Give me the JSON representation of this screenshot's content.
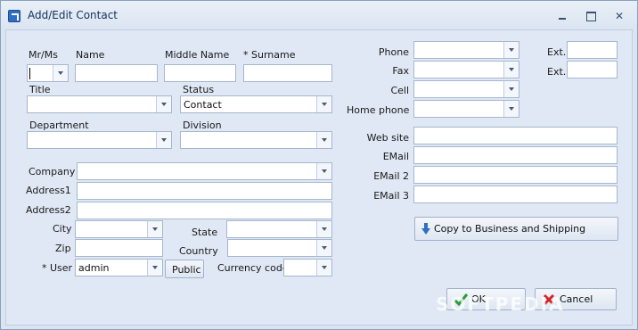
{
  "window": {
    "title": "Add/Edit Contact"
  },
  "labels": {
    "mr_ms": "Mr/Ms",
    "name": "Name",
    "middle_name": "Middle Name",
    "surname": "* Surname",
    "title": "Title",
    "status": "Status",
    "department": "Department",
    "division": "Division",
    "company": "Company",
    "address1": "Address1",
    "address2": "Address2",
    "city": "City",
    "state": "State",
    "zip": "Zip",
    "country": "Country",
    "user": "* User",
    "currency_code": "Currency code",
    "phone": "Phone",
    "fax": "Fax",
    "cell": "Cell",
    "home_phone": "Home phone",
    "ext1": "Ext.",
    "ext2": "Ext.",
    "web_site": "Web site",
    "email": "EMail",
    "email2": "EMail 2",
    "email3": "EMail 3"
  },
  "values": {
    "mr_ms": "",
    "name": "",
    "middle_name": "",
    "surname": "",
    "title": "",
    "status": "Contact",
    "department": "",
    "division": "",
    "company": "",
    "address1": "",
    "address2": "",
    "city": "",
    "state": "",
    "zip": "",
    "country": "",
    "user": "admin",
    "currency_code": "",
    "phone": "",
    "fax": "",
    "cell": "",
    "home_phone": "",
    "ext1": "",
    "ext2": "",
    "web_site": "",
    "email": "",
    "email2": "",
    "email3": ""
  },
  "buttons": {
    "public": "Public",
    "copy": "Copy to Business and Shipping",
    "ok": "OK",
    "cancel": "Cancel"
  },
  "icons": {
    "app": "app-icon",
    "copy": "arrow-down-icon",
    "ok": "check-icon",
    "cancel": "cross-icon"
  },
  "colors": {
    "accent": "#2e6fc4",
    "ok": "#2e9a3a",
    "cancel": "#d22626"
  },
  "watermark": "SOFTPEDIA"
}
